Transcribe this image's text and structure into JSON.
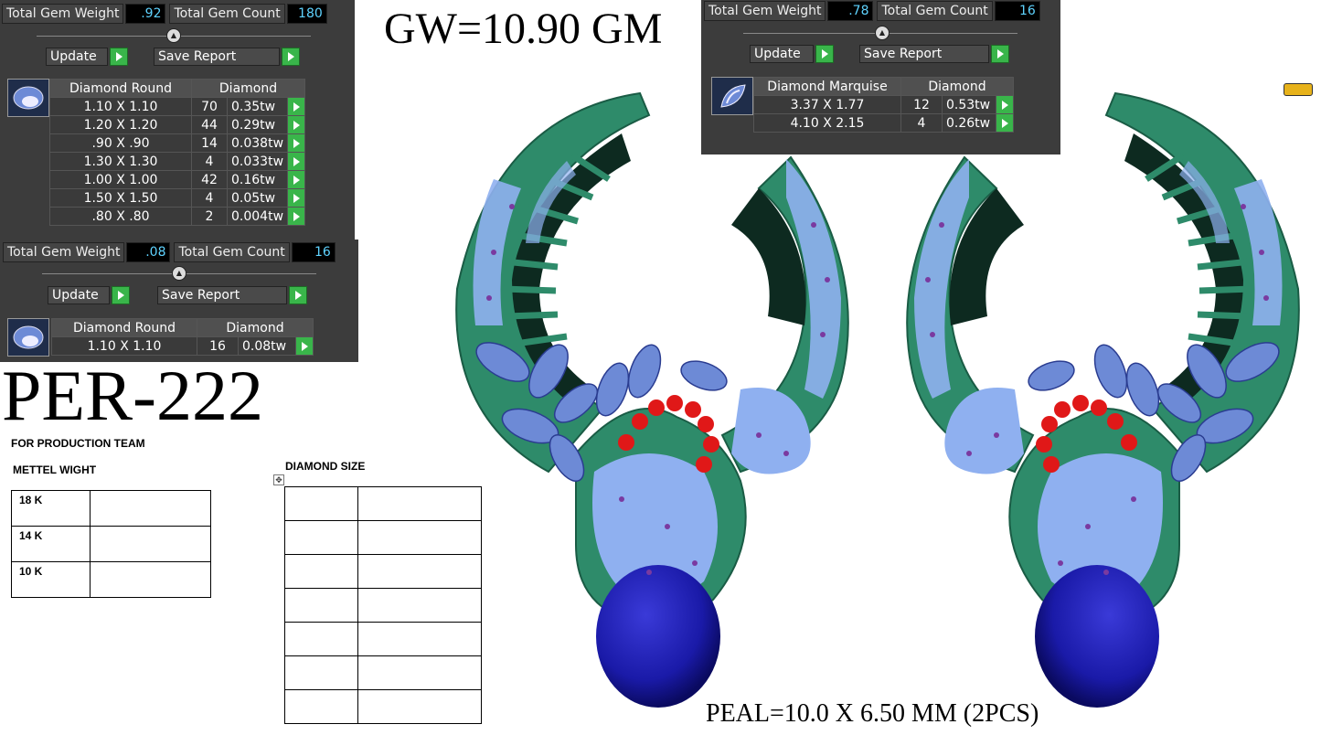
{
  "panel1": {
    "total_gem_weight_label": "Total Gem Weight",
    "total_gem_weight": ".92",
    "total_gem_count_label": "Total Gem Count",
    "total_gem_count": "180",
    "update_label": "Update",
    "save_report_label": "Save Report",
    "headers": [
      "Diamond Round",
      "Diamond"
    ],
    "rows": [
      {
        "size": "1.10 X 1.10",
        "count": "70",
        "weight": "0.35tw"
      },
      {
        "size": "1.20 X 1.20",
        "count": "44",
        "weight": "0.29tw"
      },
      {
        "size": ".90 X .90",
        "count": "14",
        "weight": "0.038tw"
      },
      {
        "size": "1.30 X 1.30",
        "count": "4",
        "weight": "0.033tw"
      },
      {
        "size": "1.00 X 1.00",
        "count": "42",
        "weight": "0.16tw"
      },
      {
        "size": "1.50 X 1.50",
        "count": "4",
        "weight": "0.05tw"
      },
      {
        "size": ".80 X .80",
        "count": "2",
        "weight": "0.004tw"
      }
    ]
  },
  "panel2": {
    "total_gem_weight_label": "Total Gem Weight",
    "total_gem_weight": ".08",
    "total_gem_count_label": "Total Gem Count",
    "total_gem_count": "16",
    "update_label": "Update",
    "save_report_label": "Save Report",
    "headers": [
      "Diamond Round",
      "Diamond"
    ],
    "rows": [
      {
        "size": "1.10 X 1.10",
        "count": "16",
        "weight": "0.08tw"
      }
    ]
  },
  "panel3": {
    "total_gem_weight_label": "Total Gem Weight",
    "total_gem_weight": ".78",
    "total_gem_count_label": "Total Gem Count",
    "total_gem_count": "16",
    "update_label": "Update",
    "save_report_label": "Save Report",
    "headers": [
      "Diamond Marquise",
      "Diamond"
    ],
    "rows": [
      {
        "size": "3.37 X 1.77",
        "count": "12",
        "weight": "0.53tw"
      },
      {
        "size": "4.10 X 2.15",
        "count": "4",
        "weight": "0.26tw"
      }
    ]
  },
  "gross_weight": "GW=10.90 GM",
  "design_code": "PER-222",
  "production": {
    "title": "FOR PRODUCTION TEAM",
    "metal_weight_label": "METTEL WIGHT",
    "karats": [
      "18 K",
      "14 K",
      "10 K"
    ],
    "diamond_size_label": "DIAMOND SIZE"
  },
  "pearl_note": "PEAL=10.0 X 6.50 MM (2PCS)",
  "colors": {
    "metal": "#2e8b6a",
    "diamond": "#8fb0f0",
    "marquise": "#5577dd",
    "ruby": "#e01818",
    "pearl": "#1a1aa8",
    "panel_bg": "#3c3c3c",
    "value_text": "#5fd3ff",
    "play_button": "#39b54a"
  }
}
